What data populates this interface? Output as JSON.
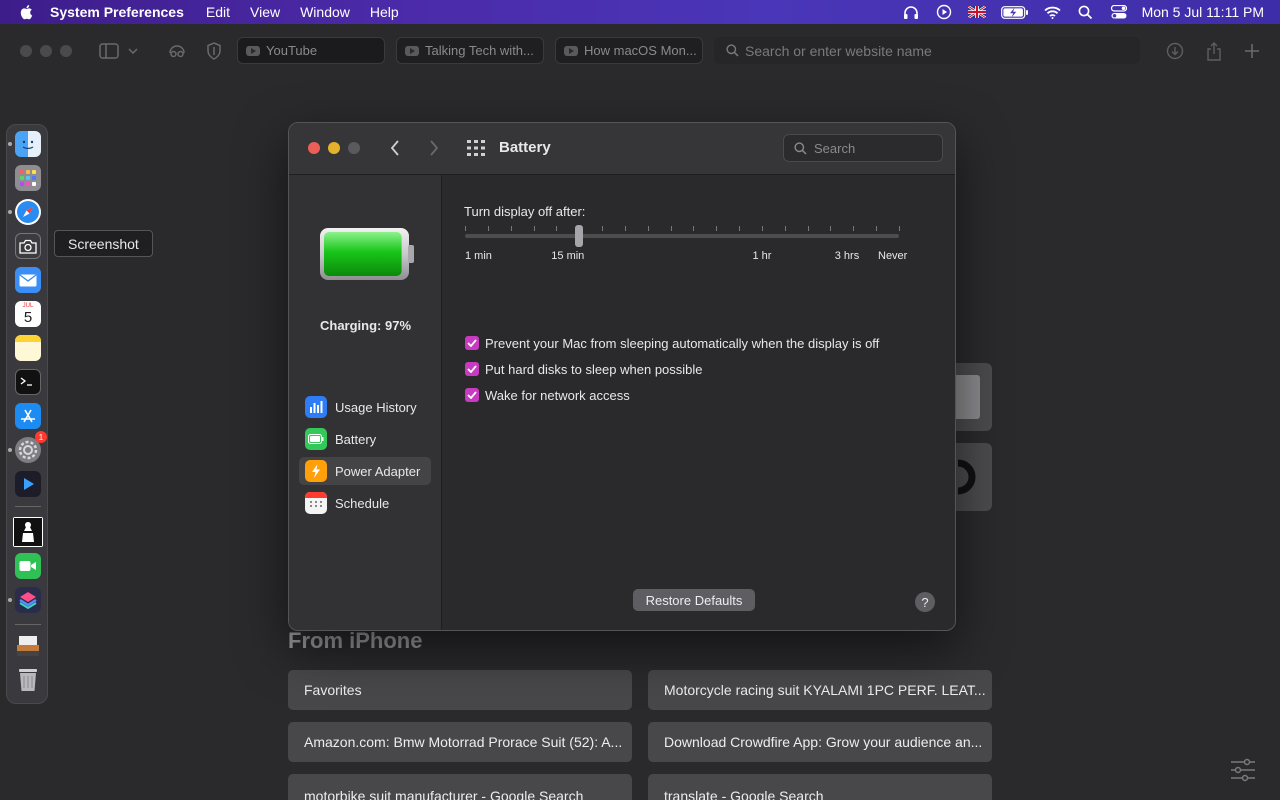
{
  "menubar": {
    "app_name": "System Preferences",
    "menus": [
      "Edit",
      "View",
      "Window",
      "Help"
    ],
    "clock": "Mon 5 Jul  11:11 PM",
    "icons": [
      "headphones-icon",
      "play-circle-icon",
      "uk-flag-icon",
      "battery-charging-icon",
      "wifi-icon",
      "spotlight-search-icon",
      "control-center-icon"
    ]
  },
  "browser": {
    "tabs": [
      "YouTube",
      "Talking Tech with...",
      "How macOS Mon..."
    ],
    "address_placeholder": "Search or enter website name"
  },
  "dock": {
    "tooltip": "Screenshot",
    "calendar_month": "JUL",
    "calendar_day": "5",
    "settings_badge": "1",
    "apps": [
      "finder",
      "launchpad",
      "safari",
      "screenshot",
      "mail",
      "calendar",
      "notes",
      "terminal",
      "app-store",
      "system-preferences",
      "infuse",
      "chess",
      "facetime",
      "shortcuts",
      "downloads",
      "trash"
    ]
  },
  "startpage": {
    "section_title": "From iPhone",
    "tiles": [
      "Favorites",
      "Motorcycle racing suit KYALAMI 1PC PERF. LEAT...",
      "Amazon.com: Bmw Motorrad Prorace Suit (52): A...",
      "Download Crowdfire App: Grow your audience an...",
      "motorbike suit manufacturer - Google Search",
      "translate - Google Search"
    ]
  },
  "prefs": {
    "title": "Battery",
    "search_placeholder": "Search",
    "charging_status": "Charging: 97%",
    "battery_level": 0.97,
    "sidebar": [
      "Usage History",
      "Battery",
      "Power Adapter",
      "Schedule"
    ],
    "selected_sidebar": "Power Adapter",
    "slider": {
      "label": "Turn display off after:",
      "tick_labels": [
        "1 min",
        "15 min",
        "1 hr",
        "3 hrs",
        "Never"
      ],
      "selected_tick": 5
    },
    "checkboxes": [
      {
        "label": "Prevent your Mac from sleeping automatically when the display is off",
        "checked": true
      },
      {
        "label": "Put hard disks to sleep when possible",
        "checked": true
      },
      {
        "label": "Wake for network access",
        "checked": true
      }
    ],
    "restore_label": "Restore Defaults",
    "help_label": "?"
  },
  "colors": {
    "accent": "#c83ac0",
    "battery_green": "#19c519",
    "close": "#ec5f57",
    "minimize": "#e5b22c"
  }
}
